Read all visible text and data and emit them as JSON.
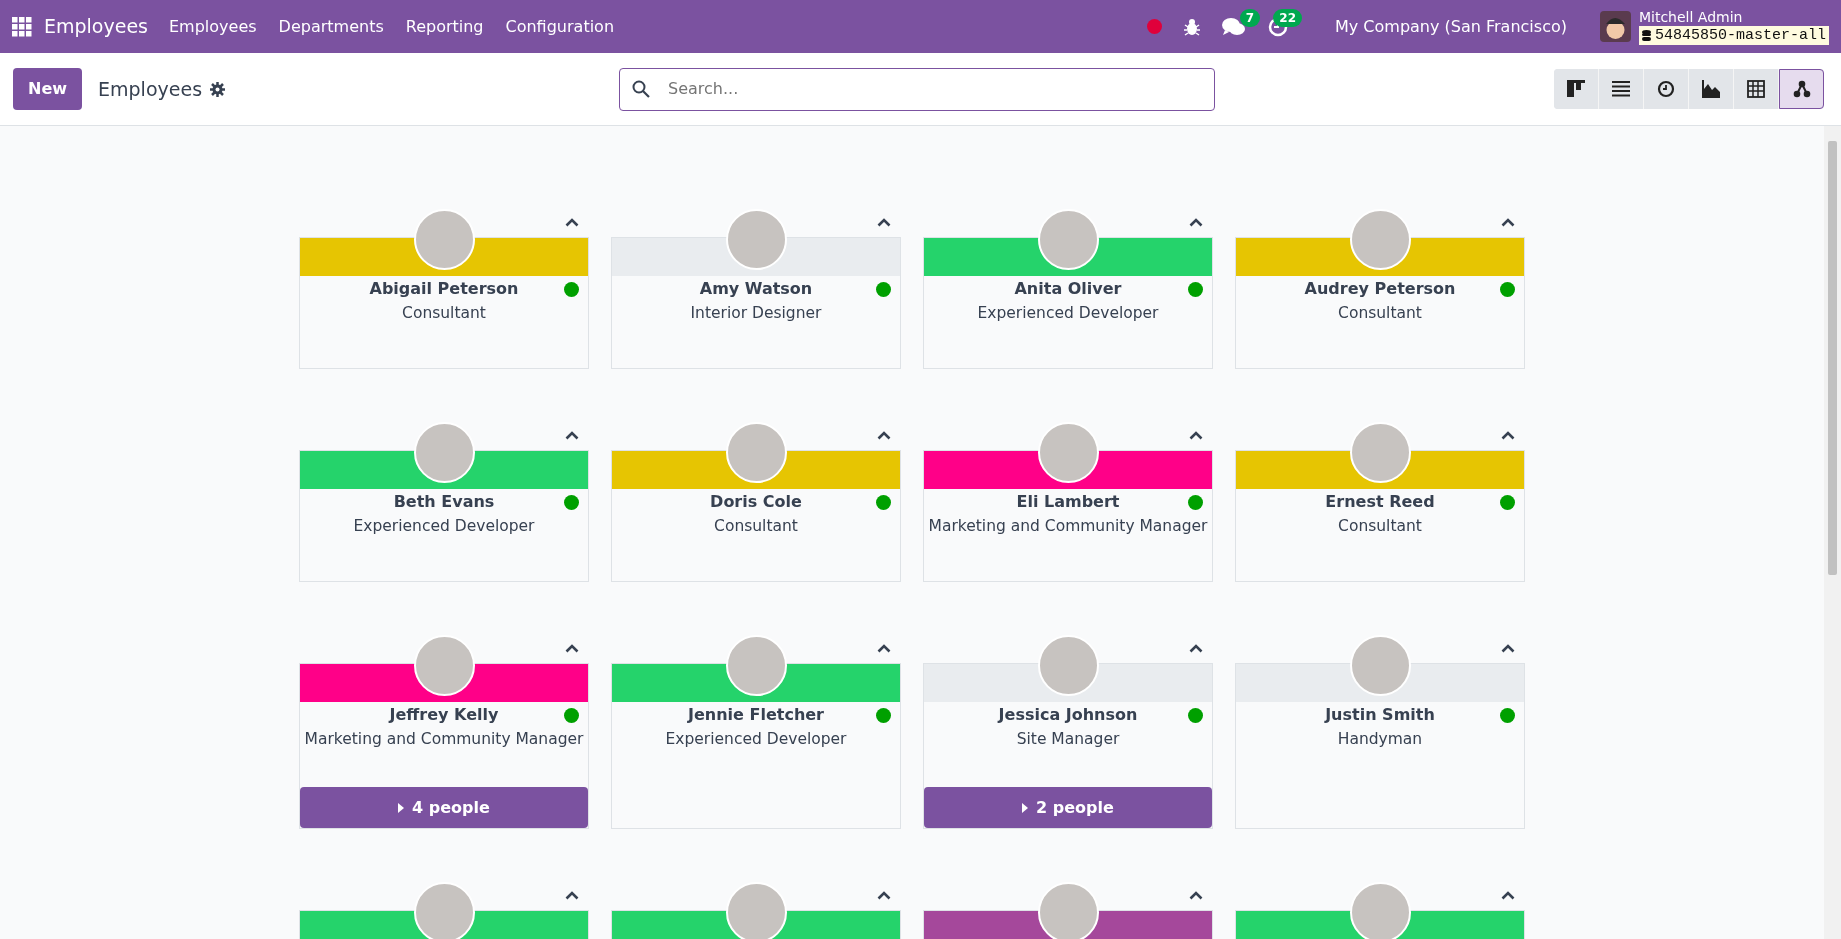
{
  "navbar": {
    "app_name": "Employees",
    "menu": [
      "Employees",
      "Departments",
      "Reporting",
      "Configuration"
    ],
    "chat_badge": "7",
    "activity_badge": "22",
    "company": "My Company (San Francisco)",
    "user_name": "Mitchell Admin",
    "database": "54845850-master-all"
  },
  "control_panel": {
    "new_button": "New",
    "breadcrumb": "Employees",
    "search": {
      "placeholder": "Search..."
    },
    "views": [
      {
        "kind": "kanban",
        "selected": false
      },
      {
        "kind": "list",
        "selected": false
      },
      {
        "kind": "activity",
        "selected": false
      },
      {
        "kind": "graph",
        "selected": false
      },
      {
        "kind": "pivot",
        "selected": false
      },
      {
        "kind": "hierarchy",
        "selected": true
      }
    ]
  },
  "employees": [
    {
      "name": "Abigail Peterson",
      "job": "Consultant",
      "color": "#e6c502"
    },
    {
      "name": "Amy Watson",
      "job": "Interior Designer",
      "color": "#e9ecef"
    },
    {
      "name": "Anita Oliver",
      "job": "Experienced Developer",
      "color": "#25d36b"
    },
    {
      "name": "Audrey Peterson",
      "job": "Consultant",
      "color": "#e6c502"
    },
    {
      "name": "Beth Evans",
      "job": "Experienced Developer",
      "color": "#25d36b"
    },
    {
      "name": "Doris Cole",
      "job": "Consultant",
      "color": "#e6c502"
    },
    {
      "name": "Eli Lambert",
      "job": "Marketing and Community Manager",
      "color": "#ff0088"
    },
    {
      "name": "Ernest Reed",
      "job": "Consultant",
      "color": "#e6c502"
    },
    {
      "name": "Jeffrey Kelly",
      "job": "Marketing and Community Manager",
      "color": "#ff0088",
      "team_button": "4 people"
    },
    {
      "name": "Jennie Fletcher",
      "job": "Experienced Developer",
      "color": "#25d36b"
    },
    {
      "name": "Jessica Johnson",
      "job": "Site Manager",
      "color": "#e9ecef",
      "team_button": "2 people"
    },
    {
      "name": "Justin Smith",
      "job": "Handyman",
      "color": "#e9ecef"
    },
    {
      "color": "#25d36b"
    },
    {
      "color": "#25d36b"
    },
    {
      "color": "#a5489b"
    },
    {
      "color": "#25d36b"
    }
  ]
}
